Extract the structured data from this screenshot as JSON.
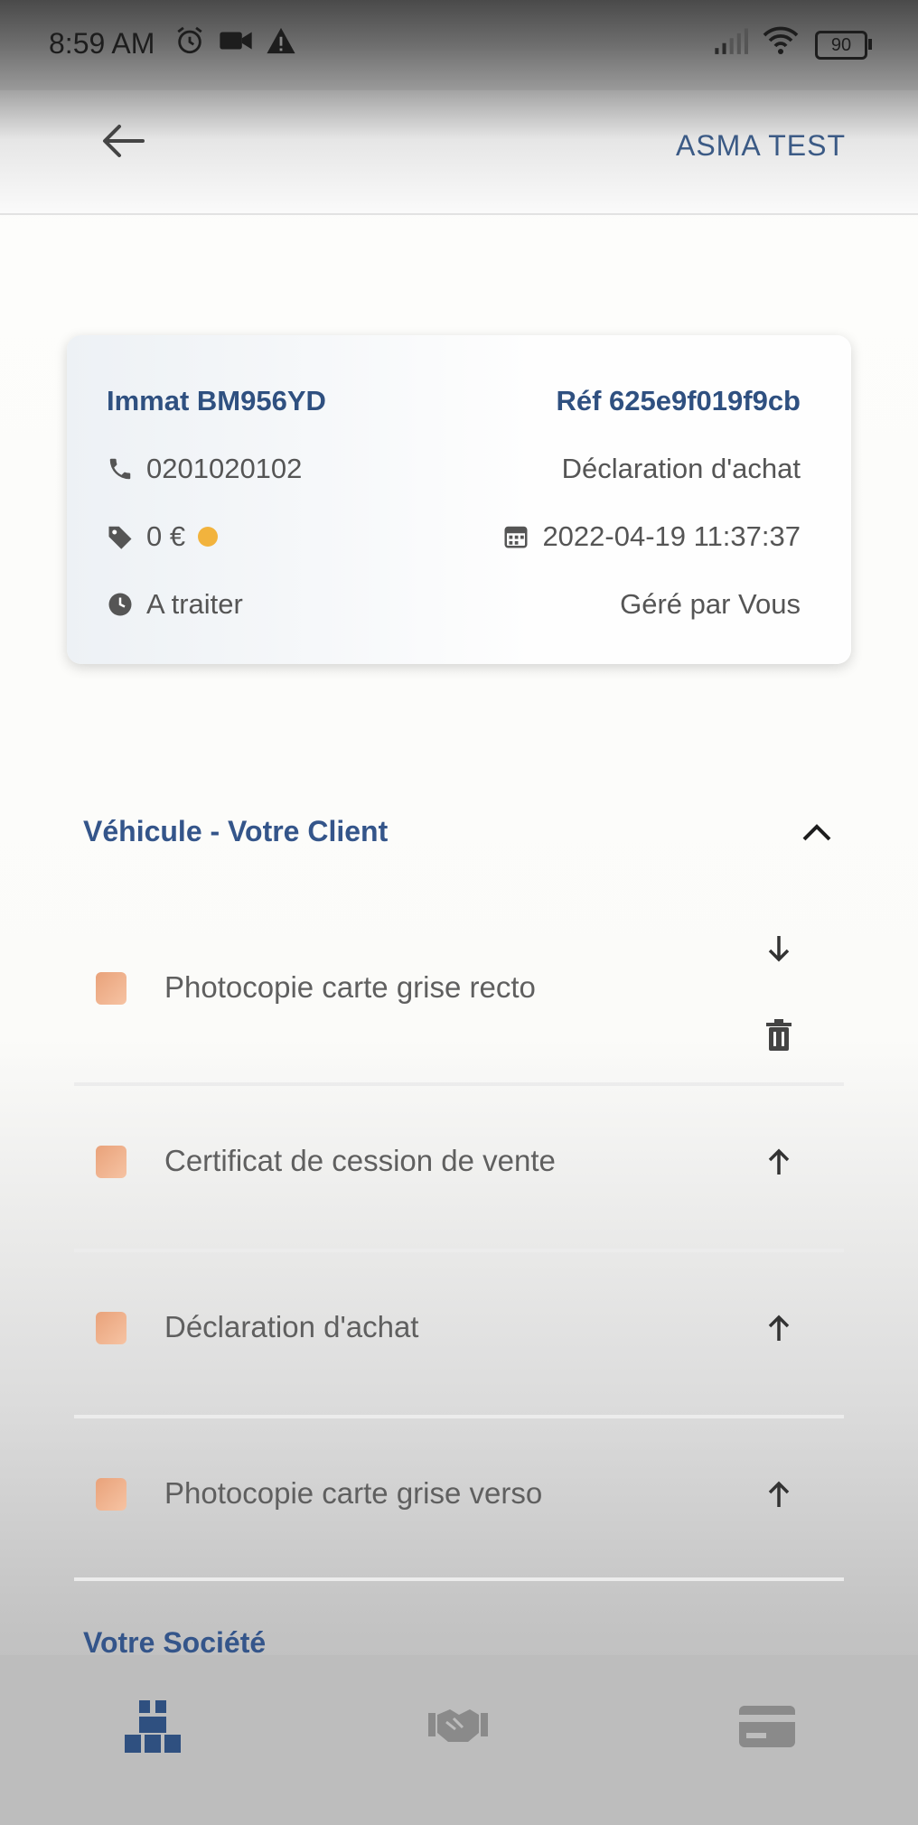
{
  "status_bar": {
    "time": "8:59 AM",
    "battery": "90"
  },
  "appbar": {
    "user_name": "ASMA TEST"
  },
  "card": {
    "immat": "Immat BM956YD",
    "ref": "Réf 625e9f019f9cb",
    "phone": "0201020102",
    "type": "Déclaration d'achat",
    "price": "0 €",
    "datetime": "2022-04-19 11:37:37",
    "status": "A traiter",
    "managed_by": "Géré par Vous"
  },
  "section": {
    "title": "Véhicule - Votre Client",
    "documents": [
      {
        "label": "Photocopie carte grise recto",
        "action": "download"
      },
      {
        "label": "Certificat de cession de vente",
        "action": "upload"
      },
      {
        "label": "Déclaration d'achat",
        "action": "upload"
      },
      {
        "label": "Photocopie carte grise verso",
        "action": "upload"
      }
    ]
  },
  "section2": {
    "title": "Votre Société"
  },
  "nav": {
    "items": [
      "warehouse-icon",
      "handshake-icon",
      "credit-card-icon"
    ]
  }
}
